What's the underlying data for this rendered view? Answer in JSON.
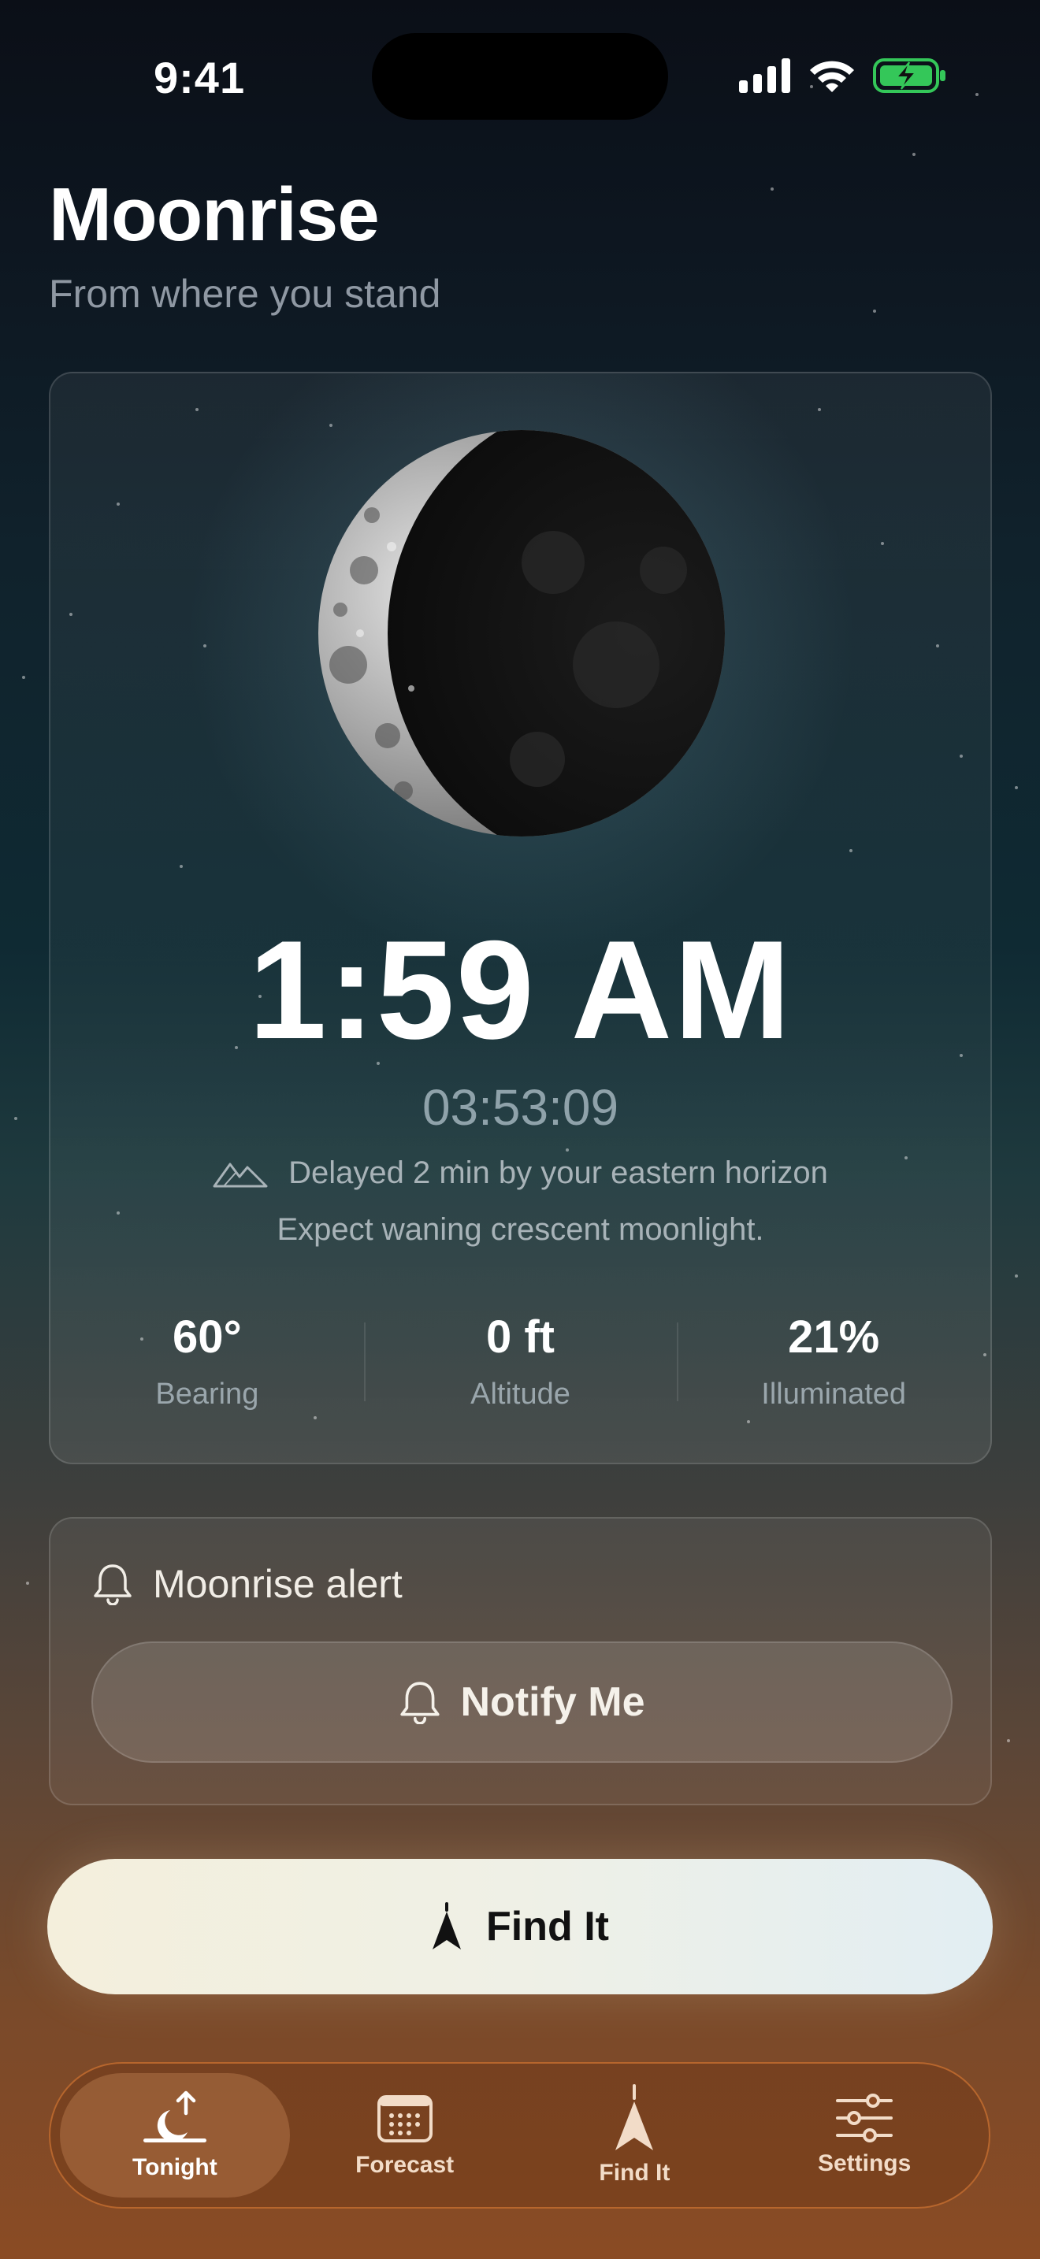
{
  "status_bar": {
    "time": "9:41"
  },
  "header": {
    "title": "Moonrise",
    "subtitle": "From where you stand"
  },
  "hero": {
    "moonrise_time": "1:59 AM",
    "countdown": "03:53:09",
    "delay_note": "Delayed 2 min by your eastern horizon",
    "expectation": "Expect waning crescent moonlight.",
    "stats": [
      {
        "value": "60°",
        "label": "Bearing"
      },
      {
        "value": "0 ft",
        "label": "Altitude"
      },
      {
        "value": "21%",
        "label": "Illuminated"
      }
    ]
  },
  "alert": {
    "title": "Moonrise alert",
    "button_label": "Notify Me"
  },
  "primary_action": {
    "label": "Find It"
  },
  "tabs": [
    {
      "label": "Tonight",
      "icon": "moonrise-icon",
      "active": true
    },
    {
      "label": "Forecast",
      "icon": "calendar-icon",
      "active": false
    },
    {
      "label": "Find It",
      "icon": "compass-arrow-icon",
      "active": false
    },
    {
      "label": "Settings",
      "icon": "sliders-icon",
      "active": false
    }
  ],
  "colors": {
    "accent_orange": "#b7662d",
    "battery_green": "#34c759"
  }
}
